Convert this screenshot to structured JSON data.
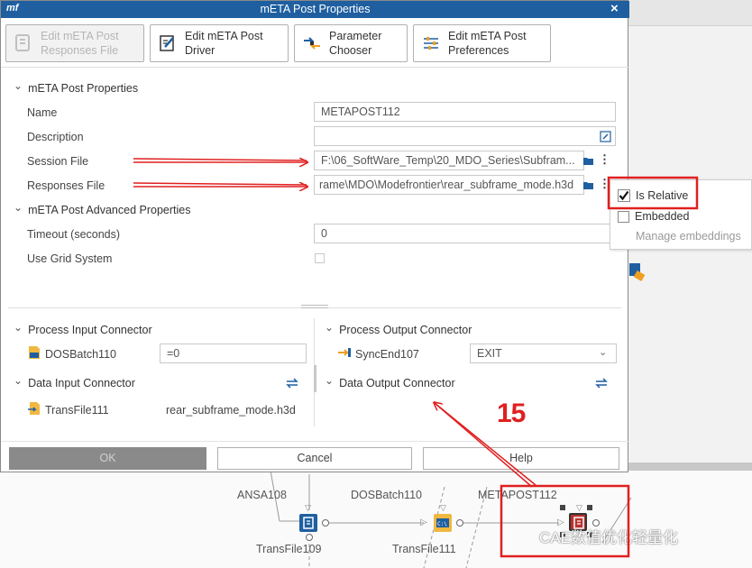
{
  "dialog": {
    "title": "mETA Post Properties",
    "logo": "mf",
    "close": "×",
    "toolbar": [
      {
        "label": "Edit mETA Post\nResponses File",
        "icon": "file-icon",
        "enabled": false
      },
      {
        "label": "Edit mETA Post\nDriver",
        "icon": "edit-icon",
        "enabled": true
      },
      {
        "label": "Parameter\nChooser",
        "icon": "arrows-icon",
        "enabled": true
      },
      {
        "label": "Edit mETA Post\nPreferences",
        "icon": "sliders-icon",
        "enabled": true
      }
    ],
    "section_main": "mETA Post Properties",
    "name_label": "Name",
    "name_value": "METAPOST112",
    "description_label": "Description",
    "description_value": "",
    "session_label": "Session File",
    "session_value": "F:\\06_SoftWare_Temp\\20_MDO_Series\\Subfram...",
    "responses_label": "Responses File",
    "responses_value": "rame\\MDO\\Modefrontier\\rear_subframe_mode.h3d",
    "section_advanced": "mETA Post Advanced Properties",
    "timeout_label": "Timeout (seconds)",
    "timeout_value": "0",
    "grid_label": "Use Grid System",
    "grid_checked": false,
    "process_input": {
      "header": "Process Input Connector",
      "node": "DOSBatch110",
      "value": "=0"
    },
    "process_output": {
      "header": "Process Output Connector",
      "node": "SyncEnd107",
      "value": "EXIT"
    },
    "data_input": {
      "header": "Data Input Connector",
      "node": "TransFile111",
      "value": "rear_subframe_mode.h3d"
    },
    "data_output": {
      "header": "Data Output Connector"
    },
    "buttons": {
      "ok": "OK",
      "cancel": "Cancel",
      "help": "Help"
    }
  },
  "popup_menu": {
    "items": [
      {
        "label": "Is Relative",
        "checked": true
      },
      {
        "label": "Embedded",
        "checked": false
      },
      {
        "label": "Manage embeddings",
        "enabled": false
      }
    ]
  },
  "annotation": {
    "number": "15",
    "color": "#e02020"
  },
  "canvas": {
    "nodes": [
      {
        "label": "ANSA108"
      },
      {
        "label": "DOSBatch110"
      },
      {
        "label": "METAPOST112"
      },
      {
        "label": "TransFile109"
      },
      {
        "label": "TransFile111"
      }
    ],
    "watermark": "CAE数值优化轻量化"
  },
  "colors": {
    "titlebar": "#1f5fa0",
    "accent": "#e02020",
    "node_blue": "#1f5fa0",
    "node_red": "#b8322e"
  }
}
